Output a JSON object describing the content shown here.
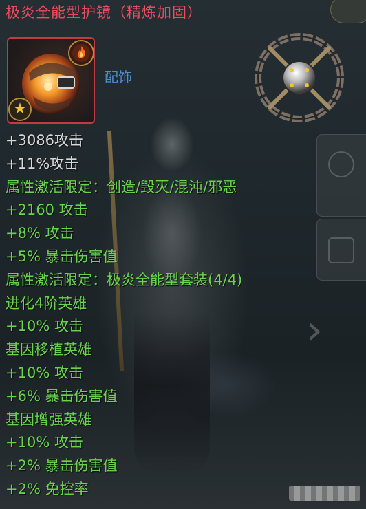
{
  "item": {
    "name": "极炎全能型护镜（精炼加固）",
    "category": "配饰",
    "icon": "fire-visor-gear-icon",
    "rarity_icon": "star-icon",
    "element_icon": "fire-element-icon",
    "set_icon": "chained-orb-set-icon"
  },
  "stats": [
    {
      "text": "+3086攻击",
      "color": "white"
    },
    {
      "text": "+11%攻击",
      "color": "white"
    },
    {
      "text": "属性激活限定：创造/毁灭/混沌/邪恶",
      "color": "green"
    },
    {
      "text": "+2160 攻击",
      "color": "green"
    },
    {
      "text": "+8% 攻击",
      "color": "green"
    },
    {
      "text": "+5% 暴击伤害值",
      "color": "green"
    },
    {
      "text": "属性激活限定：极炎全能型套装(4/4)",
      "color": "green"
    },
    {
      "text": "进化4阶英雄",
      "color": "green"
    },
    {
      "text": "+10% 攻击",
      "color": "green"
    },
    {
      "text": "基因移植英雄",
      "color": "green"
    },
    {
      "text": "+10% 攻击",
      "color": "green"
    },
    {
      "text": "+6% 暴击伤害值",
      "color": "green"
    },
    {
      "text": "基因增强英雄",
      "color": "green"
    },
    {
      "text": "+10% 攻击",
      "color": "green"
    },
    {
      "text": "+2% 暴击伤害值",
      "color": "green"
    },
    {
      "text": "+2% 免控率",
      "color": "green"
    }
  ],
  "colors": {
    "title": "#ee4b5f",
    "category": "#4d8fd0",
    "base_stat": "#d9d9d9",
    "bonus_stat": "#6bd44e"
  }
}
